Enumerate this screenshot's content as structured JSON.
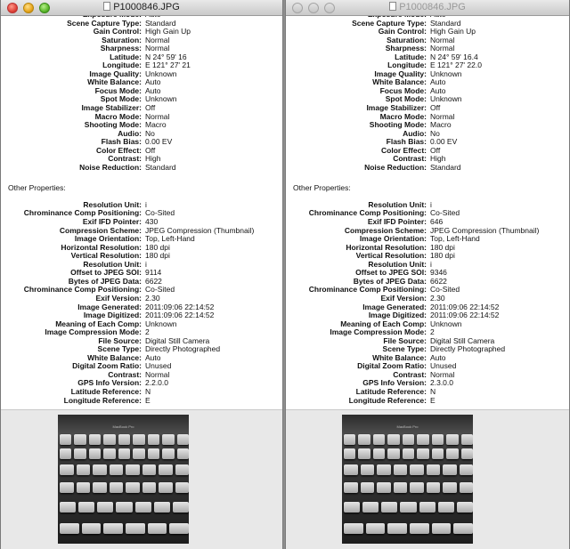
{
  "windows": [
    {
      "title": "P1000846.JPG",
      "rows": [
        {
          "label": "Exposure Mode:",
          "value": "Auto"
        },
        {
          "label": "Scene Capture Type:",
          "value": "Standard"
        },
        {
          "label": "Gain Control:",
          "value": "High Gain Up"
        },
        {
          "label": "Saturation:",
          "value": "Normal"
        },
        {
          "label": "Sharpness:",
          "value": "Normal"
        },
        {
          "label": "Latitude:",
          "value": "N 24° 59' 16"
        },
        {
          "label": "Longitude:",
          "value": "E 121° 27' 21"
        },
        {
          "label": "Image Quality:",
          "value": "Unknown"
        },
        {
          "label": "White Balance:",
          "value": "Auto"
        },
        {
          "label": "Focus Mode:",
          "value": "Auto"
        },
        {
          "label": "Spot Mode:",
          "value": "Unknown"
        },
        {
          "label": "Image Stabilizer:",
          "value": "Off"
        },
        {
          "label": "Macro Mode:",
          "value": "Normal"
        },
        {
          "label": "Shooting Mode:",
          "value": "Macro"
        },
        {
          "label": "Audio:",
          "value": "No"
        },
        {
          "label": "Flash Bias:",
          "value": "0.00 EV"
        },
        {
          "label": "Color Effect:",
          "value": "Off"
        },
        {
          "label": "Contrast:",
          "value": "High"
        },
        {
          "label": "Noise Reduction:",
          "value": "Standard"
        }
      ],
      "section_title": "Other Properties:",
      "other_rows": [
        {
          "label": "Resolution Unit:",
          "value": "i"
        },
        {
          "label": "Chrominance Comp Positioning:",
          "value": "Co-Sited"
        },
        {
          "label": "Exif IFD Pointer:",
          "value": "430"
        },
        {
          "label": "Compression Scheme:",
          "value": "JPEG Compression (Thumbnail)"
        },
        {
          "label": "Image Orientation:",
          "value": "Top, Left-Hand"
        },
        {
          "label": "Horizontal Resolution:",
          "value": "180 dpi"
        },
        {
          "label": "Vertical Resolution:",
          "value": "180 dpi"
        },
        {
          "label": "Resolution Unit:",
          "value": "i"
        },
        {
          "label": "Offset to JPEG SOI:",
          "value": "9114"
        },
        {
          "label": "Bytes of JPEG Data:",
          "value": "6622"
        },
        {
          "label": "Chrominance Comp Positioning:",
          "value": "Co-Sited"
        },
        {
          "label": "Exif Version:",
          "value": "2.30"
        },
        {
          "label": "Image Generated:",
          "value": "2011:09:06 22:14:52"
        },
        {
          "label": "Image Digitized:",
          "value": "2011:09:06 22:14:52"
        },
        {
          "label": "Meaning of Each Comp:",
          "value": "Unknown"
        },
        {
          "label": "Image Compression Mode:",
          "value": "2"
        },
        {
          "label": "File Source:",
          "value": "Digital Still Camera"
        },
        {
          "label": "Scene Type:",
          "value": "Directly Photographed"
        },
        {
          "label": "White Balance:",
          "value": "Auto"
        },
        {
          "label": "Digital Zoom Ratio:",
          "value": "Unused"
        },
        {
          "label": "Contrast:",
          "value": "Normal"
        },
        {
          "label": "GPS Info Version:",
          "value": "2.2.0.0"
        },
        {
          "label": "Latitude Reference:",
          "value": "N"
        },
        {
          "label": "Longitude Reference:",
          "value": "E"
        }
      ],
      "photo_brand": "MacBook Pro"
    },
    {
      "title": "P1000846.JPG",
      "rows": [
        {
          "label": "Exposure Mode:",
          "value": "Auto"
        },
        {
          "label": "Scene Capture Type:",
          "value": "Standard"
        },
        {
          "label": "Gain Control:",
          "value": "High Gain Up"
        },
        {
          "label": "Saturation:",
          "value": "Normal"
        },
        {
          "label": "Sharpness:",
          "value": "Normal"
        },
        {
          "label": "Latitude:",
          "value": "N 24° 59' 16.4"
        },
        {
          "label": "Longitude:",
          "value": "E 121° 27' 22.0"
        },
        {
          "label": "Image Quality:",
          "value": "Unknown"
        },
        {
          "label": "White Balance:",
          "value": "Auto"
        },
        {
          "label": "Focus Mode:",
          "value": "Auto"
        },
        {
          "label": "Spot Mode:",
          "value": "Unknown"
        },
        {
          "label": "Image Stabilizer:",
          "value": "Off"
        },
        {
          "label": "Macro Mode:",
          "value": "Normal"
        },
        {
          "label": "Shooting Mode:",
          "value": "Macro"
        },
        {
          "label": "Audio:",
          "value": "No"
        },
        {
          "label": "Flash Bias:",
          "value": "0.00 EV"
        },
        {
          "label": "Color Effect:",
          "value": "Off"
        },
        {
          "label": "Contrast:",
          "value": "High"
        },
        {
          "label": "Noise Reduction:",
          "value": "Standard"
        }
      ],
      "section_title": "Other Properties:",
      "other_rows": [
        {
          "label": "Resolution Unit:",
          "value": "i"
        },
        {
          "label": "Chrominance Comp Positioning:",
          "value": "Co-Sited"
        },
        {
          "label": "Exif IFD Pointer:",
          "value": "646"
        },
        {
          "label": "Compression Scheme:",
          "value": "JPEG Compression (Thumbnail)"
        },
        {
          "label": "Image Orientation:",
          "value": "Top, Left-Hand"
        },
        {
          "label": "Horizontal Resolution:",
          "value": "180 dpi"
        },
        {
          "label": "Vertical Resolution:",
          "value": "180 dpi"
        },
        {
          "label": "Resolution Unit:",
          "value": "i"
        },
        {
          "label": "Offset to JPEG SOI:",
          "value": "9346"
        },
        {
          "label": "Bytes of JPEG Data:",
          "value": "6622"
        },
        {
          "label": "Chrominance Comp Positioning:",
          "value": "Co-Sited"
        },
        {
          "label": "Exif Version:",
          "value": "2.30"
        },
        {
          "label": "Image Generated:",
          "value": "2011:09:06 22:14:52"
        },
        {
          "label": "Image Digitized:",
          "value": "2011:09:06 22:14:52"
        },
        {
          "label": "Meaning of Each Comp:",
          "value": "Unknown"
        },
        {
          "label": "Image Compression Mode:",
          "value": "2"
        },
        {
          "label": "File Source:",
          "value": "Digital Still Camera"
        },
        {
          "label": "Scene Type:",
          "value": "Directly Photographed"
        },
        {
          "label": "White Balance:",
          "value": "Auto"
        },
        {
          "label": "Digital Zoom Ratio:",
          "value": "Unused"
        },
        {
          "label": "Contrast:",
          "value": "Normal"
        },
        {
          "label": "GPS Info Version:",
          "value": "2.3.0.0"
        },
        {
          "label": "Latitude Reference:",
          "value": "N"
        },
        {
          "label": "Longitude Reference:",
          "value": "E"
        }
      ],
      "photo_brand": "MacBook Pro"
    }
  ]
}
